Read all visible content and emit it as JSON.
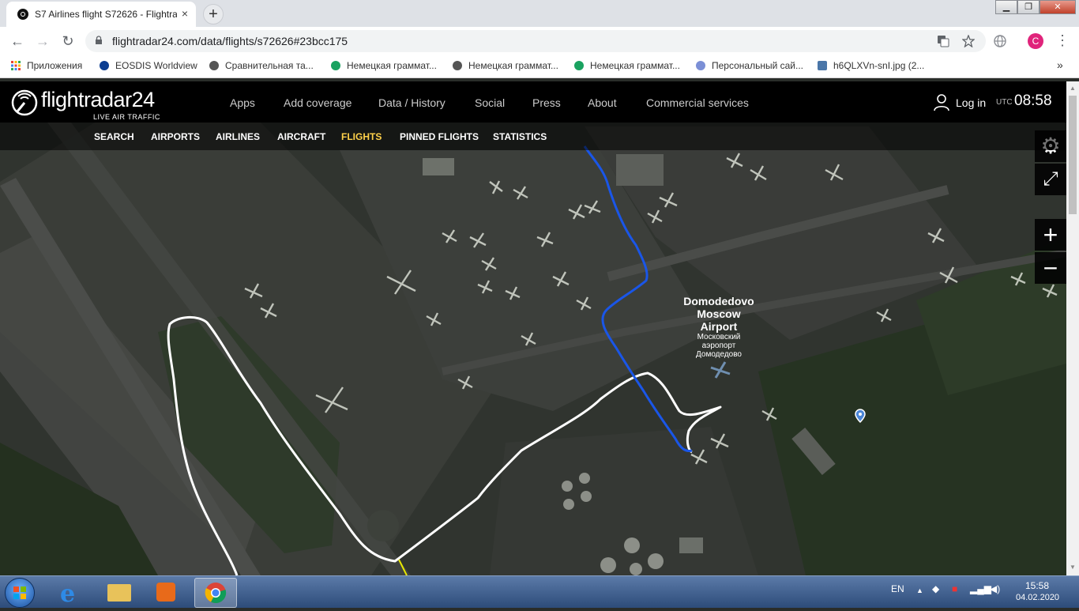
{
  "browser": {
    "tab_title": "S7 Airlines flight S72626 - Flightradar24",
    "tab_close": "×",
    "newtab": "+",
    "url": "flightradar24.com/data/flights/s72626#23bcc175",
    "profile_initial": "C",
    "window_buttons": {
      "minimize": "▁",
      "maximize": "❐",
      "close": "✕"
    },
    "nav": {
      "back": "←",
      "forward": "→",
      "reload": "↻"
    },
    "bookmarks": [
      {
        "label": "Приложения",
        "color": "#e94235"
      },
      {
        "label": "EOSDIS Worldview",
        "color": "#0b3d91"
      },
      {
        "label": "Сравнительная та...",
        "color": "#555555"
      },
      {
        "label": "Немецкая граммат...",
        "color": "#1aa260"
      },
      {
        "label": "Немецкая граммат...",
        "color": "#555555"
      },
      {
        "label": "Немецкая граммат...",
        "color": "#1aa260"
      },
      {
        "label": "Персональный сай...",
        "color": "#7b8fd6"
      },
      {
        "label": "h6QLXVn-snI.jpg (2...",
        "color": "#4a76a8"
      }
    ],
    "bookmarks_more": "»"
  },
  "site": {
    "logo": "flightradar24",
    "logo_sub": "LIVE AIR TRAFFIC",
    "main_nav": [
      "Apps",
      "Add coverage",
      "Data / History",
      "Social",
      "Press",
      "About",
      "Commercial services"
    ],
    "login": "Log in",
    "utc_label": "UTC",
    "time": "08:58",
    "sub_nav": [
      "SEARCH",
      "AIRPORTS",
      "AIRLINES",
      "AIRCRAFT",
      "FLIGHTS",
      "PINNED FLIGHTS",
      "STATISTICS"
    ],
    "active_sub": "FLIGHTS"
  },
  "map": {
    "airport_name_en": [
      "Domodedovo",
      "Moscow",
      "Airport"
    ],
    "airport_name_ru": [
      "Московский",
      "аэропорт",
      "Домодедово"
    ],
    "track_colors": {
      "white": "#ffffff",
      "blue": "#1a56e8",
      "yellow": "#e8e800"
    },
    "controls": {
      "settings": "⚙",
      "fullscreen": "⤢",
      "zoom_in": "+",
      "zoom_out": "−"
    }
  },
  "taskbar": {
    "lang": "EN",
    "time": "15:58",
    "date": "04.02.2020"
  }
}
